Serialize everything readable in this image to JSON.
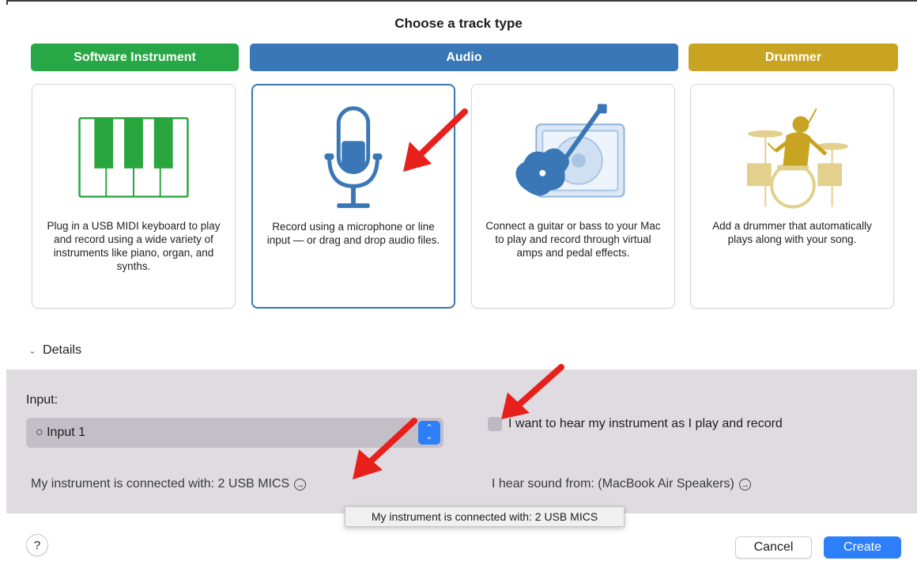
{
  "dialog": {
    "title": "Choose a track type"
  },
  "tabs": [
    {
      "label": "Software Instrument",
      "color": "#27a745"
    },
    {
      "label": "Audio",
      "color": "#3a77b6",
      "selected": true
    },
    {
      "label": "Drummer",
      "color": "#c9a422"
    }
  ],
  "cards": [
    {
      "icon": "piano-keyboard-icon",
      "desc": "Plug in a USB MIDI keyboard to play and record using a wide variety of instruments like piano, organ, and synths."
    },
    {
      "icon": "microphone-icon",
      "desc": "Record using a microphone or line input — or drag and drop audio files.",
      "selected": true
    },
    {
      "icon": "guitar-amp-icon",
      "desc": "Connect a guitar or bass to your Mac to play and record through virtual amps and pedal effects."
    },
    {
      "icon": "drummer-icon",
      "desc": "Add a drummer that automatically plays along with your song."
    }
  ],
  "details": {
    "label": "Details",
    "input_label": "Input:",
    "input_value": "○ Input 1",
    "monitor_label": "I want to hear my instrument as I play and record",
    "monitor_checked": false,
    "connected_label": "My instrument is connected with: 2 USB MICS",
    "output_label": "I hear sound from: (MacBook Air Speakers)"
  },
  "tooltip": {
    "text": "My instrument is connected with: 2 USB MICS"
  },
  "footer": {
    "help": "?",
    "cancel": "Cancel",
    "create": "Create"
  },
  "colors": {
    "accent": "#2d7ff9",
    "selection": "#3a77b6",
    "annotation_arrow": "#e8201c"
  }
}
